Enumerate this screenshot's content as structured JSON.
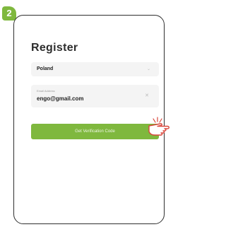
{
  "step": {
    "number": "2"
  },
  "screen": {
    "title": "Register",
    "country": {
      "value": "Poland"
    },
    "email": {
      "label": "Email Address",
      "value": "engo@gmail.com"
    },
    "button": {
      "label": "Get Verification Code"
    }
  },
  "colors": {
    "accent": "#7fb83e",
    "field_bg": "#f4f4f4",
    "text": "#2e2e2e"
  },
  "icons": {
    "dropdown": "chevron-down-icon",
    "clear": "clear-icon",
    "pointer": "pointing-hand-icon"
  }
}
